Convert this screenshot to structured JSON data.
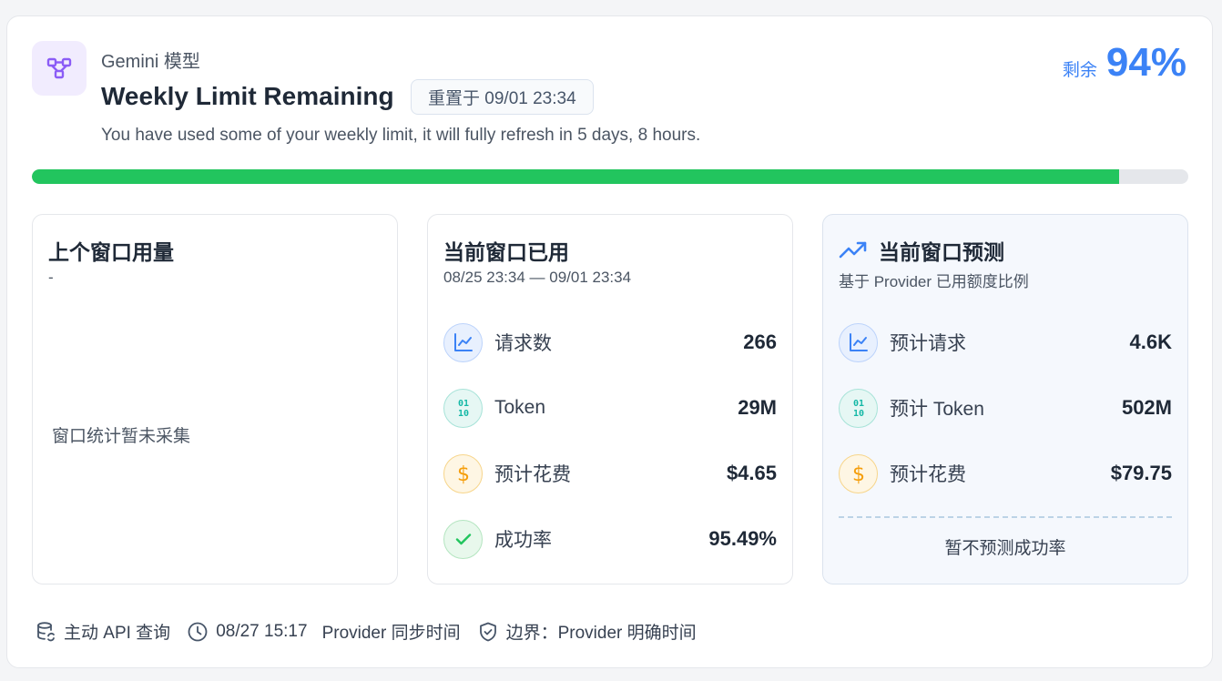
{
  "header": {
    "provider": "Gemini 模型",
    "title": "Weekly Limit Remaining",
    "reset_badge": "重置于 09/01 23:34",
    "subtitle": "You have used some of your weekly limit, it will fully refresh in 5 days, 8 hours.",
    "remain_label": "剩余",
    "remain_value": "94%",
    "remain_fraction": 0.94
  },
  "previous_window": {
    "title": "上个窗口用量",
    "subtitle": "-",
    "empty_text": "窗口统计暂未采集"
  },
  "current_window": {
    "title": "当前窗口已用",
    "range": "08/25 23:34 — 09/01 23:34",
    "stats": [
      {
        "label": "请求数",
        "value": "266",
        "icon": "line-chart-icon"
      },
      {
        "label": "Token",
        "value": "29M",
        "icon": "binary-icon"
      },
      {
        "label": "预计花费",
        "value": "$4.65",
        "icon": "dollar-icon"
      },
      {
        "label": "成功率",
        "value": "95.49%",
        "icon": "check-icon"
      }
    ]
  },
  "forecast_window": {
    "title": "当前窗口预测",
    "subtitle": "基于 Provider 已用额度比例",
    "stats": [
      {
        "label": "预计请求",
        "value": "4.6K",
        "icon": "line-chart-icon"
      },
      {
        "label": "预计 Token",
        "value": "502M",
        "icon": "binary-icon"
      },
      {
        "label": "预计花费",
        "value": "$79.75",
        "icon": "dollar-icon"
      }
    ],
    "footer": "暂不预测成功率"
  },
  "footer": {
    "source": "主动 API 查询",
    "sync_time": "08/27 15:17",
    "sync_label": "Provider 同步时间",
    "boundary": "边界：Provider 明确时间"
  },
  "colors": {
    "accent": "#3b82f6",
    "progress": "#22c55e",
    "brand": "#8b5cf6"
  }
}
